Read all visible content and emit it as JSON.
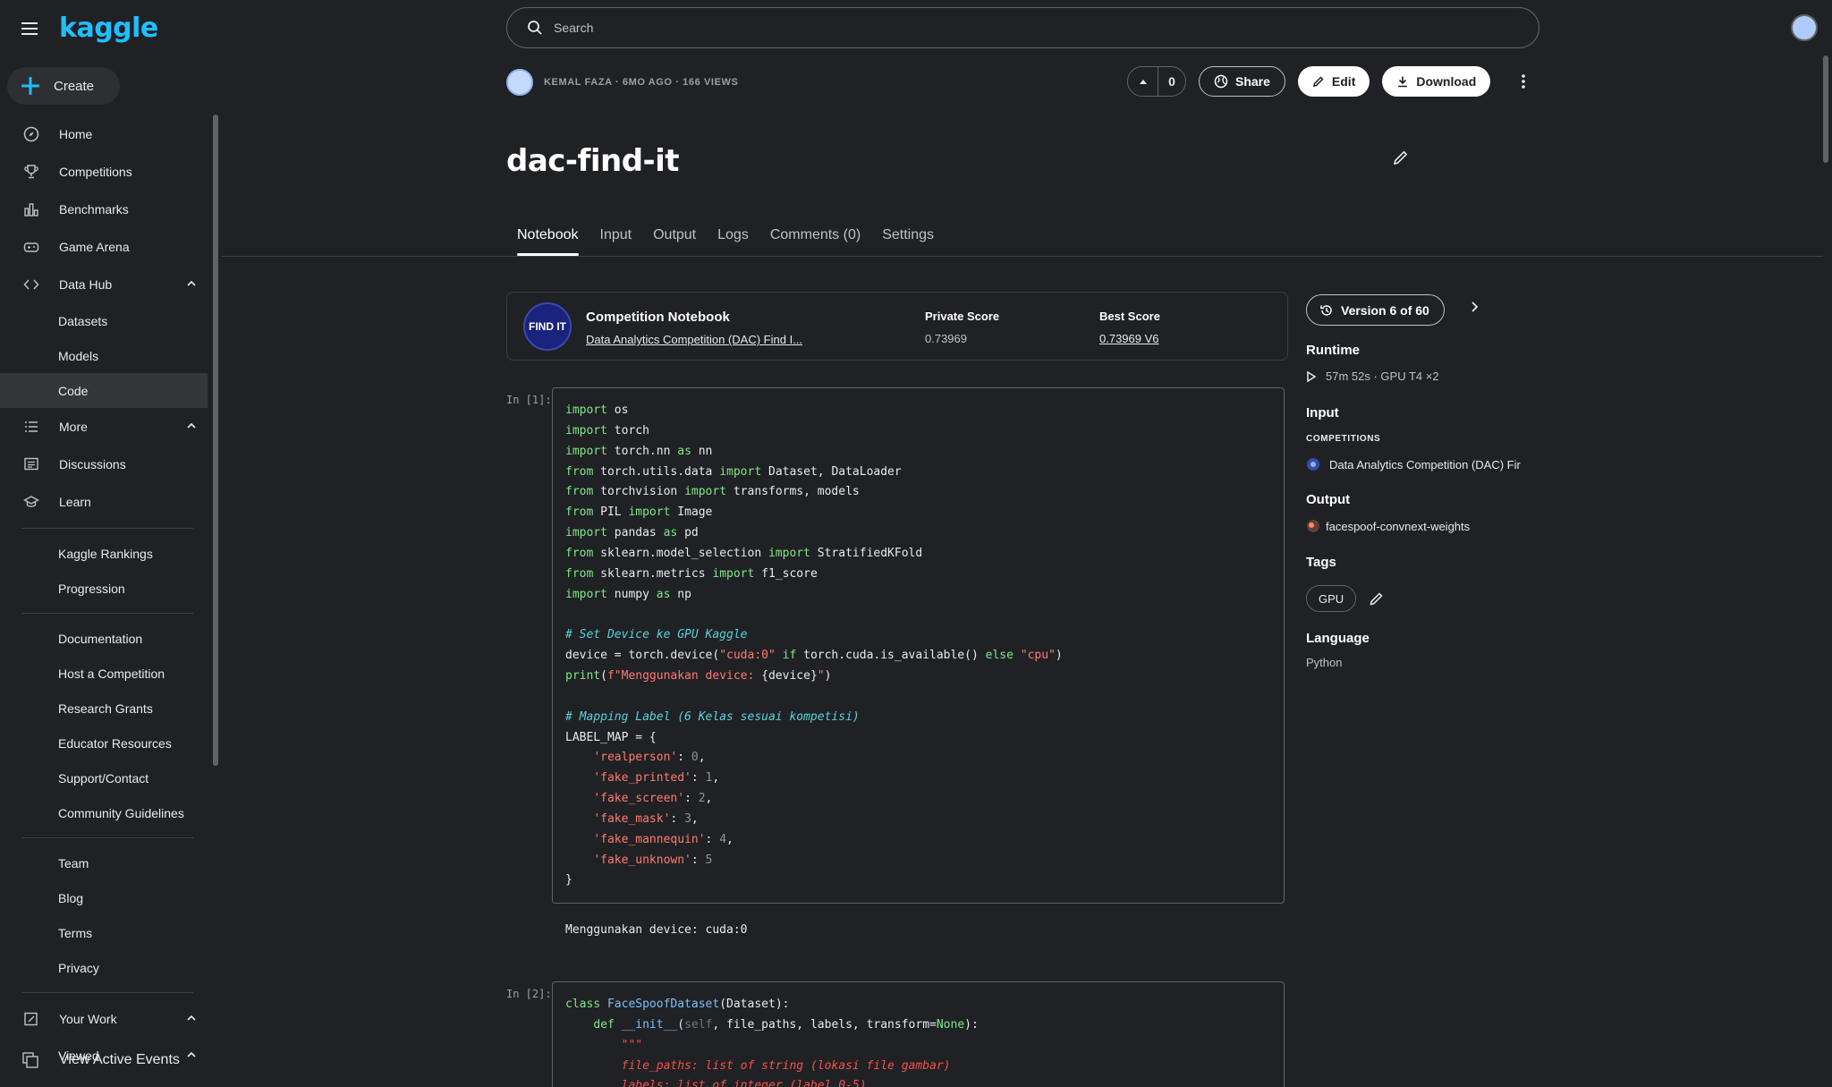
{
  "brand": {
    "logo": "kaggle"
  },
  "create": {
    "label": "Create"
  },
  "nav": {
    "home": "Home",
    "competitions": "Competitions",
    "benchmarks": "Benchmarks",
    "game_arena": "Game Arena",
    "data_hub": "Data Hub",
    "datasets": "Datasets",
    "models": "Models",
    "code": "Code",
    "more": "More",
    "discussions": "Discussions",
    "learn": "Learn",
    "kaggle_rankings": "Kaggle Rankings",
    "progression": "Progression",
    "documentation": "Documentation",
    "host_competition": "Host a Competition",
    "research_grants": "Research Grants",
    "educator_resources": "Educator Resources",
    "support_contact": "Support/Contact",
    "community_guidelines": "Community Guidelines",
    "team": "Team",
    "blog": "Blog",
    "terms": "Terms",
    "privacy": "Privacy",
    "your_work": "Your Work",
    "viewed": "Viewed",
    "view_active_events": "View Active Events"
  },
  "search": {
    "placeholder": "Search"
  },
  "meta": {
    "text": "KEMAL FAZA · 6MO AGO · 166 VIEWS"
  },
  "actions": {
    "votes": "0",
    "share": "Share",
    "edit": "Edit",
    "download": "Download"
  },
  "notebook": {
    "title": "dac-find-it"
  },
  "tabs": [
    "Notebook",
    "Input",
    "Output",
    "Logs",
    "Comments (0)",
    "Settings"
  ],
  "competition_card": {
    "logo_text": "FIND IT",
    "heading": "Competition Notebook",
    "competition_name": "Data Analytics Competition (DAC) Find I...",
    "private_score_label": "Private Score",
    "private_score": "0.73969",
    "best_score_label": "Best Score",
    "best_score": "0.73969 V6"
  },
  "right_panel": {
    "version": "Version 6 of 60",
    "runtime_label": "Runtime",
    "runtime_value": "57m 52s · GPU T4 ×2",
    "input_label": "Input",
    "competitions_label": "COMPETITIONS",
    "input_competition": "Data Analytics Competition (DAC) Fir",
    "output_label": "Output",
    "output_value": "facespoof-convnext-weights",
    "tags_label": "Tags",
    "tag": "GPU",
    "language_label": "Language",
    "language": "Python"
  },
  "cells": {
    "cell1_label": "In [1]:",
    "cell1_output": "Menggunakan device: cuda:0",
    "cell2_label": "In [2]:"
  },
  "colors": {
    "accent": "#20beff",
    "background": "#202124",
    "keyword": "#7ee787",
    "string": "#ff7b72",
    "comment": "#56d4dd"
  }
}
